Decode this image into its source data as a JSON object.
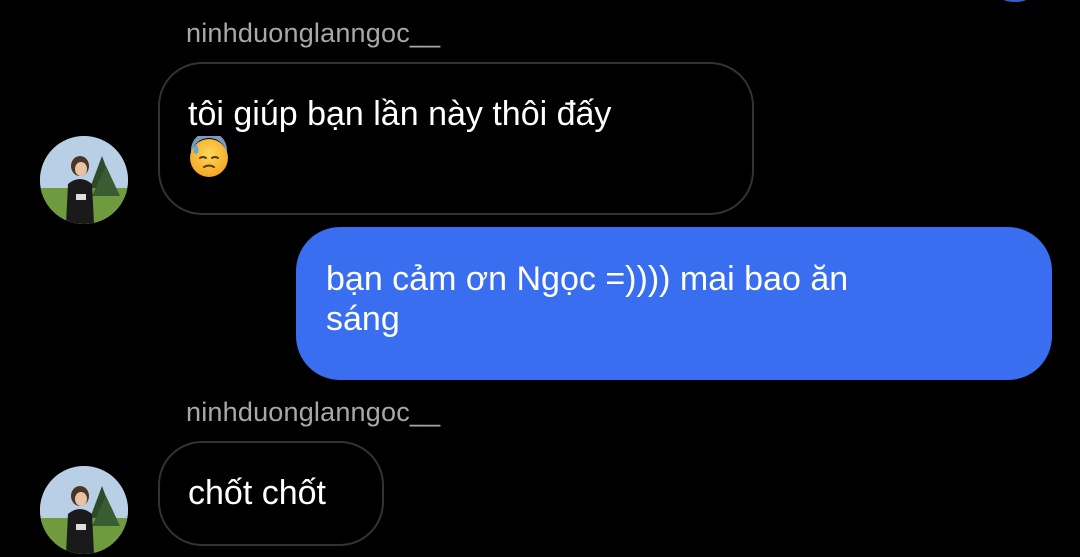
{
  "conversation": {
    "messages": [
      {
        "sender": "ninhduonglanngoc__",
        "direction": "incoming",
        "text": "tôi giúp bạn lần này thôi đấy",
        "emoji": "sweat-face-emoji"
      },
      {
        "direction": "outgoing",
        "text": "bạn cảm ơn Ngọc =)))) mai bao ăn\nsáng"
      },
      {
        "sender": "ninhduonglanngoc__",
        "direction": "incoming",
        "text": "chốt chốt"
      }
    ]
  },
  "colors": {
    "background": "#000000",
    "outgoing_bubble": "#3a6ef0",
    "incoming_border": "#333333",
    "sender_name": "#a8a8a8"
  },
  "icons": {
    "avatar": "profile-photo",
    "emoji": "downcast-face-with-sweat"
  }
}
